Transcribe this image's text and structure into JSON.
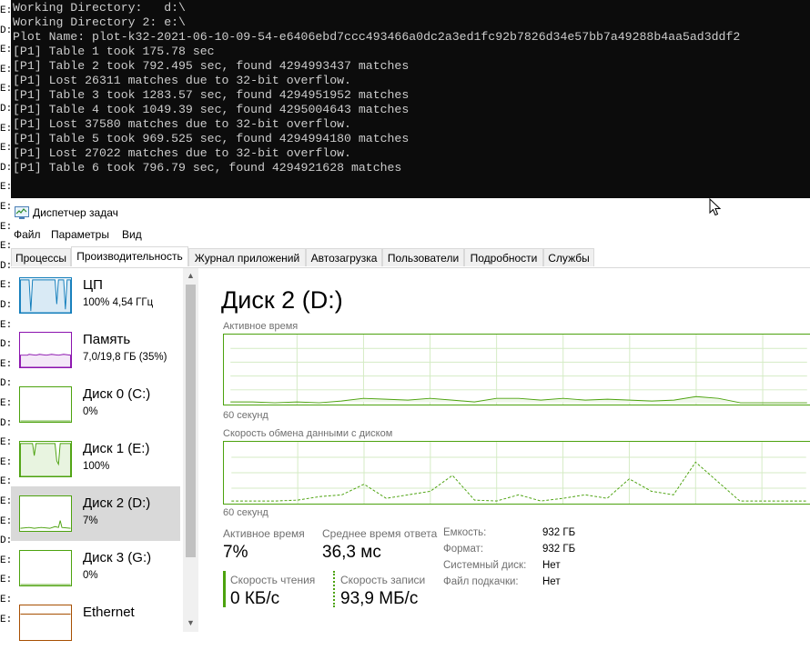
{
  "background_window": {
    "left_edge_fragments": [
      "E:\\",
      "D:\\",
      "E:\\",
      "E:\\",
      "E:\\",
      "D:\\",
      "E:\\",
      "E:\\",
      "D:\\",
      "E:\\",
      "E:\\",
      "E:\\",
      "E:\\",
      "D:\\",
      "E:\\",
      "D:\\",
      "E:\\",
      "D:\\",
      "E:\\",
      "D:\\",
      "E:\\",
      "D:\\",
      "E:\\",
      "E:\\",
      "E:\\",
      "E:\\",
      "E:\\",
      "D:\\",
      "E:\\",
      "E:\\",
      "E:\\",
      "E:\\"
    ]
  },
  "console": {
    "lines": [
      "Working Directory:   d:\\",
      "Working Directory 2: e:\\",
      "Plot Name: plot-k32-2021-06-10-09-54-e6406ebd7ccc493466a0dc2a3ed1fc92b7826d34e57bb7a49288b4aa5ad3ddf2",
      "[P1] Table 1 took 175.78 sec",
      "[P1] Table 2 took 792.495 sec, found 4294993437 matches",
      "[P1] Lost 26311 matches due to 32-bit overflow.",
      "[P1] Table 3 took 1283.57 sec, found 4294951952 matches",
      "[P1] Table 4 took 1049.39 sec, found 4295004643 matches",
      "[P1] Lost 37580 matches due to 32-bit overflow.",
      "[P1] Table 5 took 969.525 sec, found 4294994180 matches",
      "[P1] Lost 27022 matches due to 32-bit overflow.",
      "[P1] Table 6 took 796.79 sec, found 4294921628 matches"
    ]
  },
  "window": {
    "title": "Диспетчер задач",
    "menu": [
      "Файл",
      "Параметры",
      "Вид"
    ],
    "tabs": [
      "Процессы",
      "Производительность",
      "Журнал приложений",
      "Автозагрузка",
      "Пользователи",
      "Подробности",
      "Службы"
    ],
    "active_tab": 1
  },
  "sidebar": {
    "items": [
      {
        "name": "ЦП",
        "sub": "100%  4,54 ГГц",
        "color": "#117dbb"
      },
      {
        "name": "Память",
        "sub": "7,0/19,8 ГБ (35%)",
        "color": "#8b12ae"
      },
      {
        "name": "Диск 0 (C:)",
        "sub": "0%",
        "color": "#4ca20e"
      },
      {
        "name": "Диск 1 (E:)",
        "sub": "100%",
        "color": "#4ca20e"
      },
      {
        "name": "Диск 2 (D:)",
        "sub": "7%",
        "color": "#4ca20e",
        "selected": true
      },
      {
        "name": "Диск 3 (G:)",
        "sub": "0%",
        "color": "#4ca20e"
      },
      {
        "name": "Ethernet",
        "sub": "",
        "color": "#a74f01"
      }
    ]
  },
  "main": {
    "title": "Диск 2 (D:)",
    "graph1_label": "Активное время",
    "graph1_time": "60 секунд",
    "graph2_label": "Скорость обмена данными с диском",
    "graph2_time": "60 секунд",
    "stats": {
      "active_time_label": "Активное время",
      "active_time_value": "7%",
      "avg_response_label": "Среднее время ответа",
      "avg_response_value": "36,3 мс",
      "read_speed_label": "Скорость чтения",
      "read_speed_value": "0 КБ/с",
      "write_speed_label": "Скорость записи",
      "write_speed_value": "93,9 МБ/с"
    },
    "properties": [
      {
        "label": "Емкость:",
        "value": "932 ГБ"
      },
      {
        "label": "Формат:",
        "value": "932 ГБ"
      },
      {
        "label": "Системный диск:",
        "value": "Нет"
      },
      {
        "label": "Файл подкачки:",
        "value": "Нет"
      }
    ]
  }
}
